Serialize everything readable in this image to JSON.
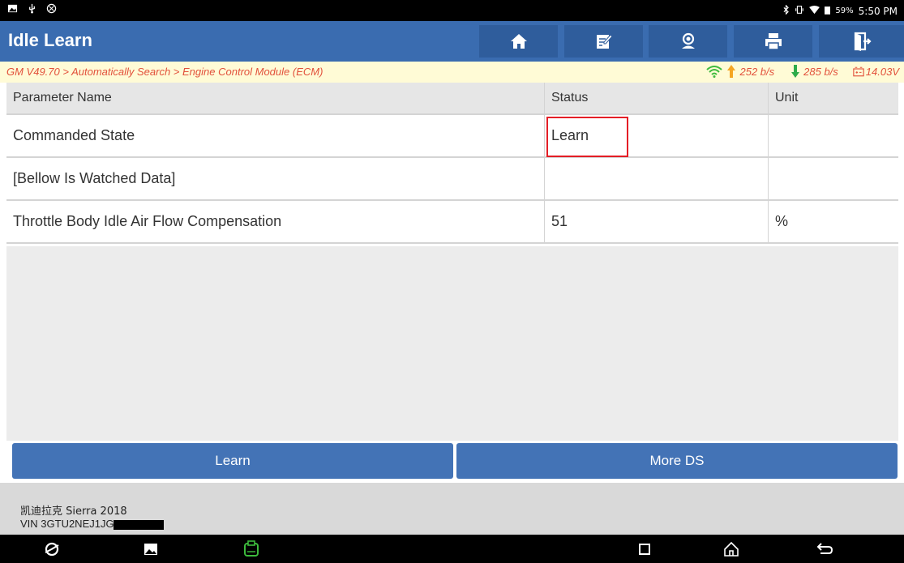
{
  "status_bar": {
    "left_icons": [
      "image-icon",
      "usb-icon",
      "settings-circle-icon"
    ],
    "battery": "59%",
    "time": "5:50 PM"
  },
  "header": {
    "title": "Idle Learn",
    "toolbar": [
      "home-icon",
      "edit-icon",
      "user-support-icon",
      "print-icon",
      "exit-icon"
    ]
  },
  "breadcrumb": {
    "path": "GM V49.70 > Automatically Search > Engine Control Module (ECM)",
    "upload_speed": "252 b/s",
    "download_speed": "285 b/s",
    "voltage": "14.03V"
  },
  "table": {
    "headers": {
      "name": "Parameter Name",
      "status": "Status",
      "unit": "Unit"
    },
    "rows": [
      {
        "name": "Commanded State",
        "status": "Learn",
        "unit": ""
      },
      {
        "name": "[Bellow Is Watched Data]",
        "status": "",
        "unit": ""
      },
      {
        "name": "Throttle Body Idle Air Flow Compensation",
        "status": "51",
        "unit": "%"
      }
    ]
  },
  "actions": {
    "learn": "Learn",
    "more_ds": "More DS"
  },
  "vehicle_info": {
    "vehicle": "凯迪拉克 Sierra 2018",
    "vin": "VIN 3GTU2NEJ1JG2"
  },
  "colors": {
    "header_blue": "#3a6cb0",
    "button_blue": "#4373b6",
    "breadcrumb_bg": "#fffbd6",
    "breadcrumb_text": "#e2513b",
    "highlight_red": "#e41e26",
    "upload_arrow": "#f5a623",
    "download_arrow": "#2eab4a",
    "vci_green": "#3dbb3d"
  }
}
